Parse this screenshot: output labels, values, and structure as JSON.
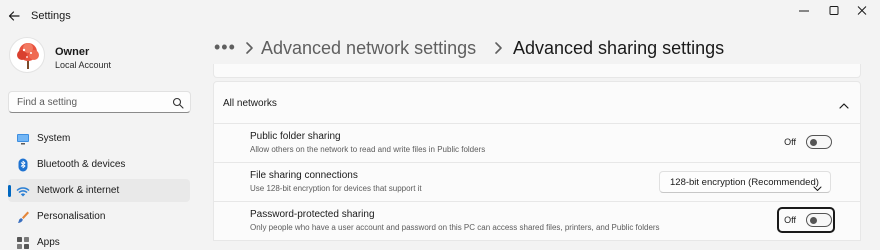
{
  "window": {
    "app_title": "Settings"
  },
  "user": {
    "name": "Owner",
    "account_type": "Local Account"
  },
  "search": {
    "placeholder": "Find a setting"
  },
  "nav": [
    {
      "label": "System",
      "icon": "monitor-icon"
    },
    {
      "label": "Bluetooth & devices",
      "icon": "bluetooth-icon"
    },
    {
      "label": "Network & internet",
      "icon": "wifi-icon",
      "selected": true
    },
    {
      "label": "Personalisation",
      "icon": "paintbrush-icon"
    },
    {
      "label": "Apps",
      "icon": "apps-icon"
    }
  ],
  "breadcrumb": {
    "overflow": "•••",
    "parent": "Advanced network settings",
    "current": "Advanced sharing settings"
  },
  "section": {
    "title": "All networks",
    "expanded": true
  },
  "settings": {
    "public_folder": {
      "title": "Public folder sharing",
      "description": "Allow others on the network to read and write files in Public folders",
      "state": "Off"
    },
    "file_sharing": {
      "title": "File sharing connections",
      "description": "Use 128-bit encryption for devices that support it",
      "value": "128-bit encryption (Recommended)"
    },
    "password_protected": {
      "title": "Password-protected sharing",
      "description": "Only people who have a user account and password on this PC can access shared files, printers, and Public folders",
      "state": "Off"
    }
  },
  "colors": {
    "accent": "#0067c0",
    "background": "#f3f3f3",
    "card": "#fbfbfb"
  }
}
